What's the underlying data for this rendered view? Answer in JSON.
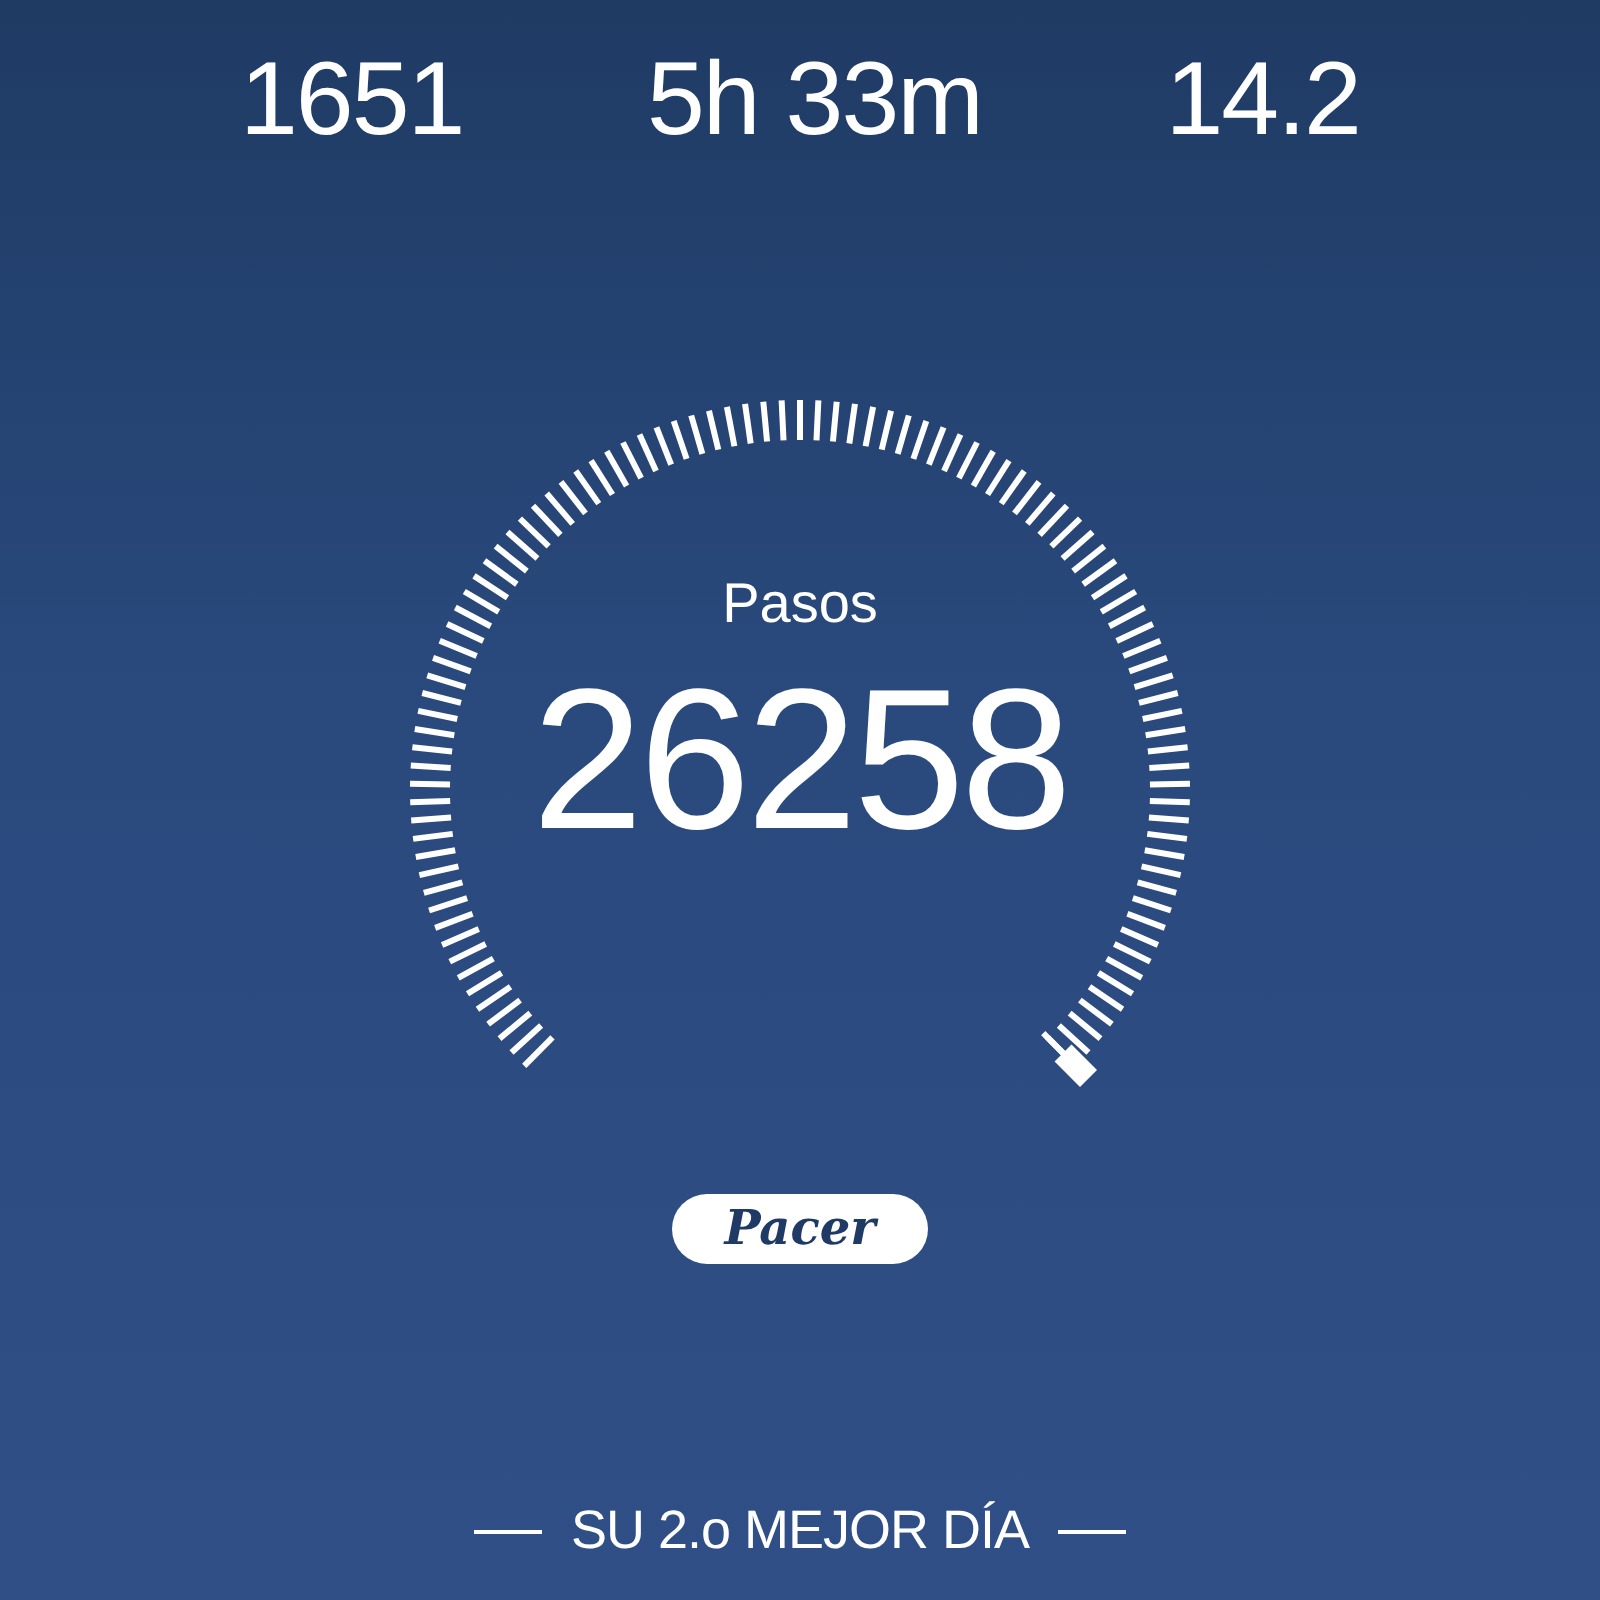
{
  "stats": [
    {
      "value": "1651"
    },
    {
      "value": "5h 33m"
    },
    {
      "value": "14.2"
    }
  ],
  "gauge": {
    "label": "Pasos",
    "value": "26258"
  },
  "logo": "Pacer",
  "footer": "SU 2.o MEJOR DÍA"
}
